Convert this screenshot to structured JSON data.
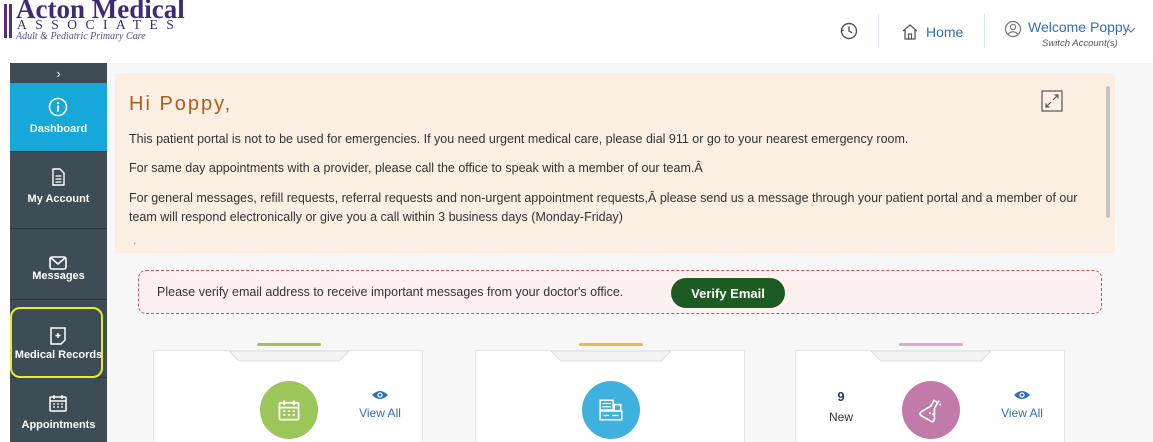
{
  "brand": {
    "name": "Acton Medical",
    "subtitle": "ASSOCIATES",
    "tagline": "Adult & Pediatric Primary Care",
    "color": "#3d2a78"
  },
  "header": {
    "history_icon": "history-icon",
    "home_label": "Home",
    "welcome_label": "Welcome Poppy",
    "switch_label": "Switch Account(s)"
  },
  "sidebar": {
    "toggle": "›",
    "items": [
      {
        "label": "Dashboard",
        "icon": "info-icon",
        "active": true
      },
      {
        "label": "My Account",
        "icon": "document-icon",
        "active": false
      },
      {
        "label": "Messages",
        "icon": "envelope-icon",
        "active": false
      },
      {
        "label": "Medical Records",
        "icon": "medical-record-icon",
        "active": false
      },
      {
        "label": "Appointments",
        "icon": "calendar-icon",
        "active": false
      }
    ],
    "bg_color": "#3e4c55",
    "active_color": "#15a8d8",
    "highlight_color": "#e8ec2a"
  },
  "announcement": {
    "greeting": "Hi Poppy,",
    "p1": "This patient portal is not to be used for emergencies. If you need urgent medical care, please dial 911 or go to your nearest emergency room.",
    "p2": "For same day appointments with a provider, please call the office to speak with a member of our team.Â",
    "p3": "For general messages, refill requests, referral requests and non-urgent appointment requests,Â  please send us a message through your patient portal and a member of our team will respond electronically or give you a call within 3 business days (Monday-Friday)",
    "dot": "."
  },
  "verify": {
    "text": "Please verify email address to receive important messages from your doctor's office.",
    "button_label": "Verify Email"
  },
  "cards": [
    {
      "icon": "calendar-icon",
      "accent": "#9dc65a",
      "view_all": "View All"
    },
    {
      "icon": "pharmacy-icon",
      "accent": "#3fb1de",
      "view_all": ""
    },
    {
      "icon": "lab-flask-icon",
      "accent": "#c27ba9",
      "view_all": "View All",
      "new_count": "9",
      "new_label": "New"
    }
  ]
}
